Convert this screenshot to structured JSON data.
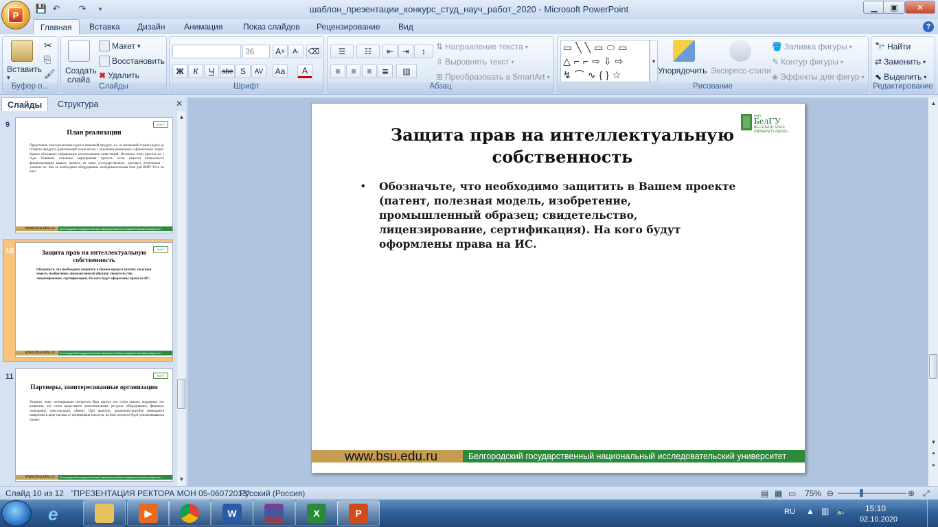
{
  "window": {
    "title": "шаблон_презентации_конкурс_студ_науч_работ_2020 - Microsoft PowerPoint"
  },
  "tabs": [
    "Главная",
    "Вставка",
    "Дизайн",
    "Анимация",
    "Показ слайдов",
    "Рецензирование",
    "Вид"
  ],
  "ribbon": {
    "clipboard": {
      "label": "Буфер о...",
      "paste": "Вставить"
    },
    "slides": {
      "label": "Слайды",
      "new_slide_1": "Создать",
      "new_slide_2": "слайд",
      "layout": "Макет",
      "reset": "Восстановить",
      "delete": "Удалить"
    },
    "font": {
      "label": "Шрифт",
      "size": "36"
    },
    "paragraph": {
      "label": "Абзац",
      "text_direction": "Направление текста",
      "align_text": "Выровнять текст",
      "smartart": "Преобразовать в SmartArt"
    },
    "drawing": {
      "label": "Рисование",
      "arrange": "Упорядочить",
      "quick_styles": "Экспресс-стили",
      "fill": "Заливка фигуры",
      "outline": "Контур фигуры",
      "effects": "Эффекты для фигур"
    },
    "editing": {
      "label": "Редактирование",
      "find": "Найти",
      "replace": "Заменить",
      "select": "Выделить"
    }
  },
  "pane": {
    "tab_slides": "Слайды",
    "tab_outline": "Структура"
  },
  "thumbnails": [
    {
      "num": "9",
      "title": "План реализации",
      "body": "Представьте план реализации идеи в конечный продукт, т.е. от начальной стадии (идеи) до готового продукта (работающей технологии) с указанием временных и финансовых затрат. Кратко обозначьте направление использования инвестиций. Изложите план проекта на 2 года. Опишите основные мероприятия проекта. Если имеется возможность финансирования вашего проекта из иных (государственных, частных) источников – укажите их. Как ее необходимо оборудование экспериментальная база для НИР? Есть ли она?"
    },
    {
      "num": "10",
      "title": "Защита прав на интеллектуальную собственность",
      "body": "Обозначьте, что необходимо защитить в Вашем проекте (патент, полезная модель, изобретение, промышленный образец; свидетельство, лицензирование, сертификация). На кого будут оформлены права на ИС."
    },
    {
      "num": "11",
      "title": "Партнеры, заинтересованные организации",
      "body": "Укажите, кому потенциально интересен Ваш проект, кто готов оказать поддержку его развитию, кто готов представить дополнительные ресурсы (оборудование, финансы, помещение, консультации, обмен). При наличии, продемонстрируйте имеющиеся намерения в виде письма от организации или вуза, на базе которого будет реализовываться проект."
    }
  ],
  "footer": {
    "site": "www.bsu.edu.ru",
    "university": "Белгородский государственный национальный исследовательский университет"
  },
  "slide": {
    "title": "Защита прав на интеллектуальную собственность",
    "bullet_mark": "•",
    "body": "Обозначьте, что необходимо защитить в Вашем проекте (патент, полезная модель, изобретение, промышленный образец; свидетельство, лицензирование, сертификация). На кого будут оформлены права на ИС.",
    "logo_top": "НИУ",
    "logo_name": "БелГУ",
    "logo_line2": "BELGOROD STATE",
    "logo_line3": "UNIVERSITY (BelSU)"
  },
  "status": {
    "slide_pos": "Слайд 10 из 12",
    "theme": "\"ПРЕЗЕНТАЦИЯ РЕКТОРА МОН 05-06072013\"",
    "lang": "Русский (Россия)",
    "zoom": "75%"
  },
  "tray": {
    "lang": "RU",
    "time": "15:10",
    "date": "02.10.2020"
  },
  "colors": {
    "accent_gold": "#c49c52",
    "accent_green": "#2c8a3a",
    "selection": "#f3a444"
  }
}
